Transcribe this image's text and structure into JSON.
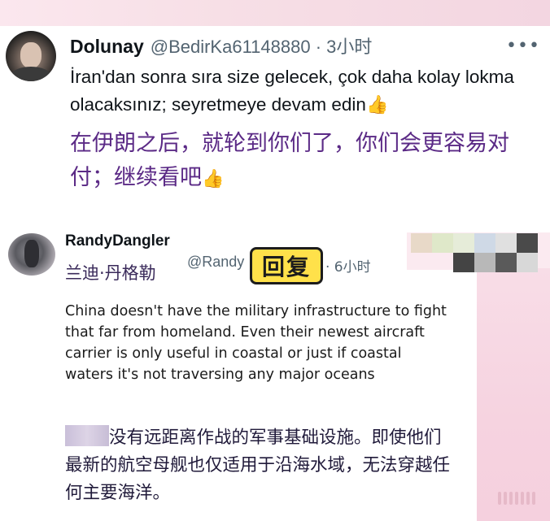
{
  "tweet1": {
    "display_name": "Dolunay",
    "handle_time": "@BedirKa61148880 · 3小时",
    "more_icon": "ellipsis-icon",
    "text_tr": "İran'dan sonra sıra size gelecek, çok daha kolay lokma olacaksınız; seyretmeye devam edin",
    "text_zh": "在伊朗之后，就轮到你们了，你们会更容易对付；继续看吧",
    "emoji_icon": "thumbs-up-icon",
    "emoji_char": "👍"
  },
  "tweet2": {
    "display_name": "RandyDangler",
    "display_name_zh": "兰迪·丹格勒",
    "handle": "@Randy",
    "time": "· 6小时",
    "reply_sticker": "回复",
    "text_en": "China doesn't have the military infrastructure to fight that far from homeland. Even their newest aircraft carrier is only useful in coastal or just if coastal waters it's not traversing any major oceans",
    "text_zh": "没有远距离作战的军事基础设施。即使他们最新的航空母舰也仅适用于沿海水域，无法穿越任何主要海洋。"
  },
  "colors": {
    "zh_translation_purple": "#5b2a86",
    "sticker_yellow": "#ffe14a",
    "handle_gray": "#536471",
    "pink_background": "#f6d3e0"
  }
}
